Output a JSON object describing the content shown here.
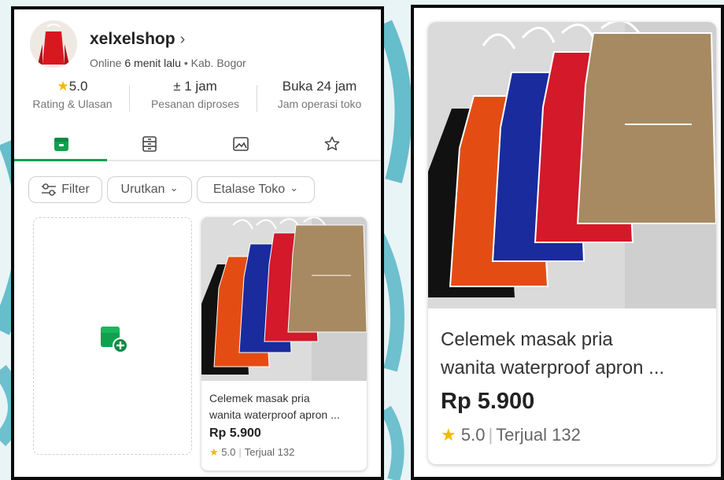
{
  "shop": {
    "name": "xelxelshop",
    "chevron": "›",
    "online_prefix": "Online",
    "online_time": "6 menit lalu",
    "dot": "•",
    "location": "Kab. Bogor"
  },
  "stats": [
    {
      "value": "5.0",
      "label": "Rating & Ulasan",
      "icon": "star-icon"
    },
    {
      "value": "± 1 jam",
      "label": "Pesanan diproses"
    },
    {
      "value": "Buka 24 jam",
      "label": "Jam operasi toko"
    }
  ],
  "tabs": [
    {
      "icon": "store-icon",
      "active": true
    },
    {
      "icon": "catalog-icon",
      "active": false
    },
    {
      "icon": "gallery-icon",
      "active": false
    },
    {
      "icon": "star-outline-icon",
      "active": false
    }
  ],
  "filters": {
    "filter_label": "Filter",
    "sort_label": "Urutkan",
    "showcase_label": "Etalase Toko",
    "caret": "⌄"
  },
  "product": {
    "title_line1": "Celemek masak pria",
    "title_line2_small": "wanita waterproof apron ...",
    "title_line2_big": "wanita waterproof apron ...",
    "price": "Rp 5.900",
    "rating": "5.0",
    "separator": "|",
    "sold": "Terjual 132"
  },
  "colors": {
    "accent_green": "#0fa14f",
    "star_yellow": "#f5b800",
    "frame_black": "#0a0a0a",
    "bg_teal": "#4fb3c4"
  }
}
